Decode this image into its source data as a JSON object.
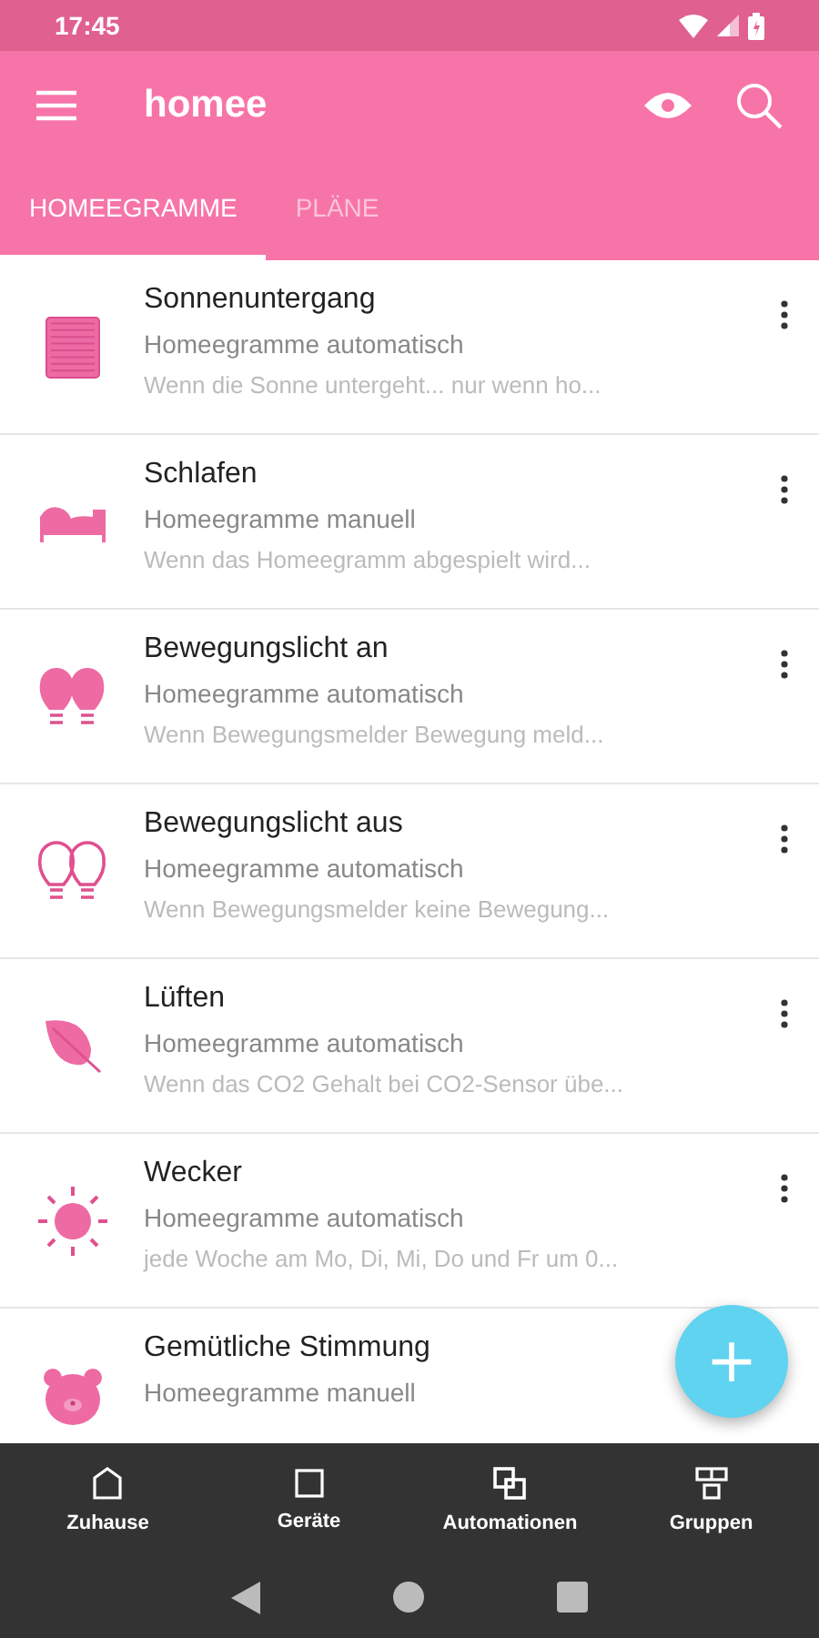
{
  "status_bar": {
    "time": "17:45"
  },
  "app_bar": {
    "title": "homee"
  },
  "tabs": [
    {
      "label": "HOMEEGRAMME",
      "selected": true
    },
    {
      "label": "PLÄNE",
      "selected": false
    }
  ],
  "homeegrams": [
    {
      "kind": "blinds",
      "title": "Sonnenuntergang",
      "type": "Homeegramme automatisch",
      "description": "Wenn die Sonne untergeht... nur wenn ho...",
      "menu": true
    },
    {
      "kind": "bed",
      "title": "Schlafen",
      "type": "Homeegramme manuell",
      "description": "Wenn das Homeegramm abgespielt wird...",
      "menu": true
    },
    {
      "kind": "bulbs-on",
      "title": "Bewegungslicht an",
      "type": "Homeegramme automatisch",
      "description": "Wenn Bewegungsmelder Bewegung meld...",
      "menu": true
    },
    {
      "kind": "bulbs-off",
      "title": "Bewegungslicht aus",
      "type": "Homeegramme automatisch",
      "description": "Wenn Bewegungsmelder keine Bewegung...",
      "menu": true
    },
    {
      "kind": "leaf",
      "title": "Lüften",
      "type": "Homeegramme automatisch",
      "description": "Wenn das CO2 Gehalt bei CO2-Sensor übe...",
      "menu": true
    },
    {
      "kind": "sun",
      "title": "Wecker",
      "type": "Homeegramme automatisch",
      "description": "jede Woche am Mo, Di, Mi, Do und Fr um 0...",
      "menu": true
    },
    {
      "kind": "bear",
      "title": "Gemütliche Stimmung",
      "type": "Homeegramme manuell",
      "menu": false
    }
  ],
  "fab": {
    "symbol": "+"
  },
  "bottom_nav": [
    {
      "kind": "home",
      "label": "Zuhause"
    },
    {
      "kind": "device",
      "label": "Geräte"
    },
    {
      "kind": "automation",
      "label": "Automationen"
    },
    {
      "kind": "groups",
      "label": "Gruppen"
    }
  ]
}
